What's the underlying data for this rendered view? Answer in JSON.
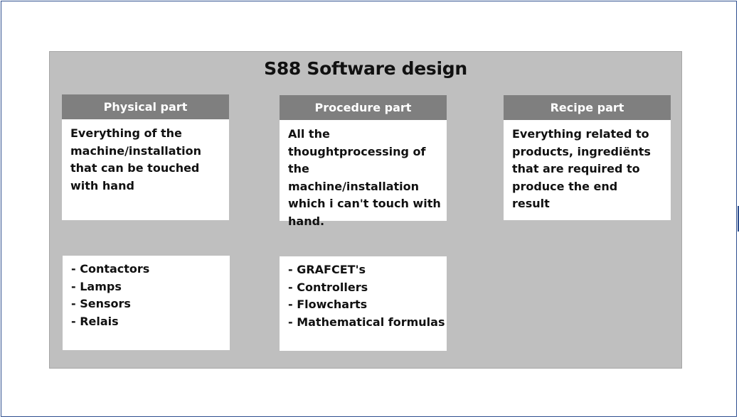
{
  "diagram": {
    "title": "S88 Software design",
    "cards": [
      {
        "header": "Physical part",
        "description": "Everything of the machine/installation that can be touched with hand",
        "items": [
          "- Contactors",
          "- Lamps",
          "- Sensors",
          "- Relais"
        ]
      },
      {
        "header": "Procedure part",
        "description": "All the thoughtprocessing of the machine/installation which i can't touch with hand.",
        "items": [
          "- GRAFCET's",
          "- Controllers",
          "- Flowcharts",
          "- Mathematical formulas"
        ]
      },
      {
        "header": "Recipe part",
        "description": "Everything related to products, ingrediënts that are required to produce the end result"
      }
    ]
  },
  "colors": {
    "panel_background": "#bfbfbf",
    "header_background": "#7f7f7f",
    "card_background": "#ffffff",
    "frame_border": "#2f4f8f"
  }
}
